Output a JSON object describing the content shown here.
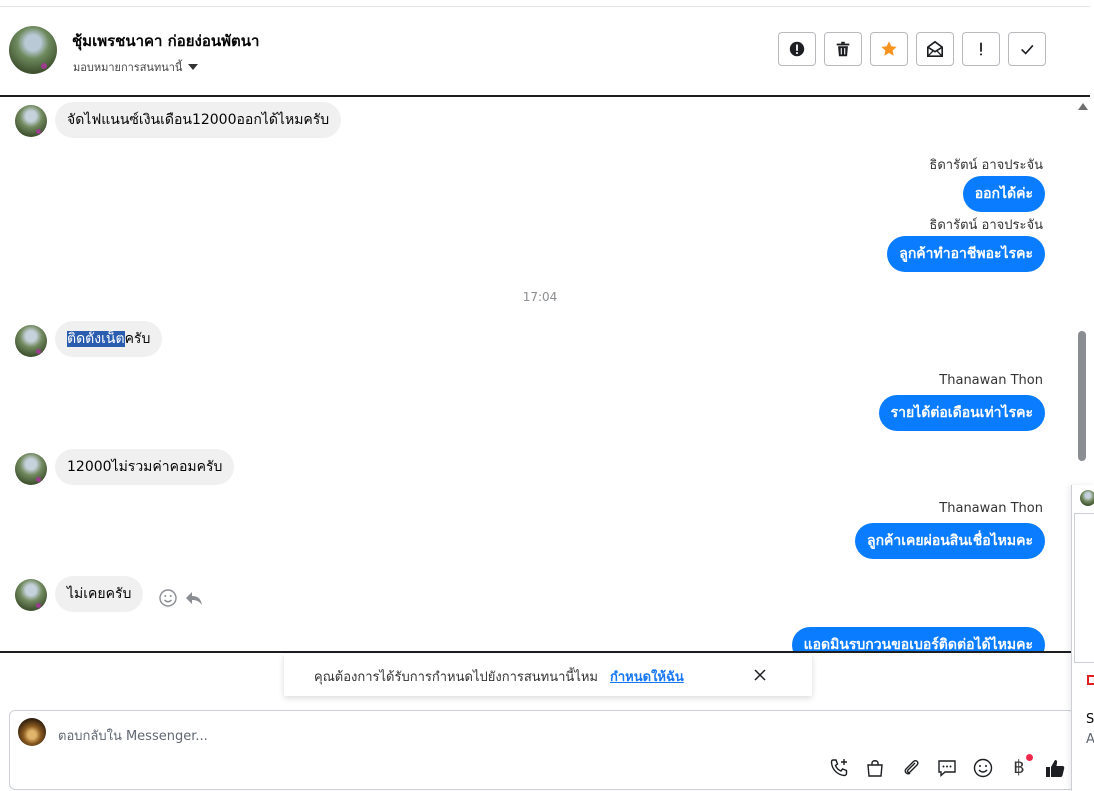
{
  "header": {
    "contact_name": "ชุ้มเพรชนาคา ก่อยง่อนพัตนา",
    "assign_label": "มอบหมายการสนทนานี้"
  },
  "actions": [
    {
      "name": "report-spam-button",
      "icon": "alert-circle-icon"
    },
    {
      "name": "delete-button",
      "icon": "trash-icon"
    },
    {
      "name": "star-button",
      "icon": "star-icon",
      "color": "#f7931e"
    },
    {
      "name": "mark-unread-button",
      "icon": "envelope-open-icon"
    },
    {
      "name": "mark-important-button",
      "icon": "exclamation-icon"
    },
    {
      "name": "mark-done-button",
      "icon": "check-icon"
    }
  ],
  "messages": {
    "m1": "จัดไฟแนนซ์เงินเดือน12000ออกได้ไหมครับ",
    "s1": "ธิดารัตน์ อาจประจัน",
    "m2": "ออกได้ค่ะ",
    "s2": "ธิดารัตน์ อาจประจัน",
    "m3": "ลูกค้าทำอาชีพอะไรคะ",
    "time": "17:04",
    "m4_highlight": "ติดตั้งเน็ต",
    "m4_rest": "ครับ",
    "s3": "Thanawan Thon",
    "m5": "รายได้ต่อเดือนเท่าไรคะ",
    "m6": "12000ไม่รวมค่าคอมครับ",
    "s4": "Thanawan Thon",
    "m7": "ลูกค้าเคยผ่อนสินเชื่อไหมคะ",
    "m8": "ไม่เคยครับ",
    "m9": "แอดมินรบกวนขอเบอร์ติดต่อได้ไหมคะ"
  },
  "notify": {
    "text": "คุณต้องการได้รับการกำหนดไปยังการสนทนานี้ไหม",
    "link": "กำหนดให้ฉัน"
  },
  "composer": {
    "placeholder": "ตอบกลับใน Messenger..."
  },
  "right_panel": {
    "line1": "S",
    "line2": "A"
  },
  "colors": {
    "outgoing_bubble": "#0a7cff",
    "incoming_bubble": "#f0f0f0",
    "link": "#1877f2"
  }
}
